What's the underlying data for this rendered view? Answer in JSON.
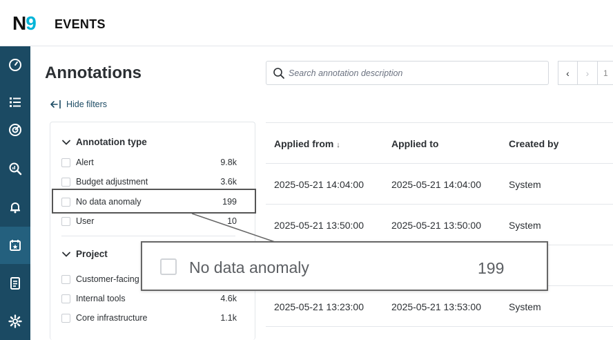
{
  "header": {
    "logo_n": "N",
    "logo_nine": "9",
    "title": "EVENTS"
  },
  "sidebar": {
    "items": [
      {
        "icon": "dashboard-gauge-icon"
      },
      {
        "icon": "list-icon"
      },
      {
        "icon": "target-icon"
      },
      {
        "icon": "analysis-search-icon"
      },
      {
        "icon": "bell-icon"
      },
      {
        "icon": "calendar-star-icon",
        "active": true
      },
      {
        "icon": "report-icon"
      },
      {
        "icon": "settings-gear-icon"
      }
    ]
  },
  "main": {
    "title": "Annotations",
    "search_placeholder": "Search annotation description",
    "pager": {
      "prev": "‹",
      "next": "›",
      "page": "1"
    },
    "hide_filters": "Hide filters"
  },
  "filters": {
    "annotation_type": {
      "label": "Annotation type",
      "options": [
        {
          "label": "Alert",
          "count": "9.8k"
        },
        {
          "label": "Budget adjustment",
          "count": "3.6k"
        },
        {
          "label": "No data anomaly",
          "count": "199"
        },
        {
          "label": "User",
          "count": "10"
        }
      ]
    },
    "project": {
      "label": "Project",
      "options": [
        {
          "label": "Customer-facing",
          "count": ""
        },
        {
          "label": "Internal tools",
          "count": "4.6k"
        },
        {
          "label": "Core infrastructure",
          "count": "1.1k"
        }
      ]
    }
  },
  "table": {
    "columns": [
      "Applied from",
      "Applied to",
      "Created by"
    ],
    "sort_indicator": "↓",
    "rows": [
      [
        "2025-05-21 14:04:00",
        "2025-05-21 14:04:00",
        "System"
      ],
      [
        "2025-05-21 13:50:00",
        "2025-05-21 13:50:00",
        "System"
      ],
      [
        "",
        "",
        ""
      ],
      [
        "2025-05-21 13:23:00",
        "2025-05-21 13:53:00",
        "System"
      ]
    ]
  },
  "zoom_callout": {
    "label": "No data anomaly",
    "count": "199"
  },
  "colors": {
    "sidebar": "#1b4a63",
    "sidebar_active": "#24607e",
    "accent": "#00b4d8"
  }
}
